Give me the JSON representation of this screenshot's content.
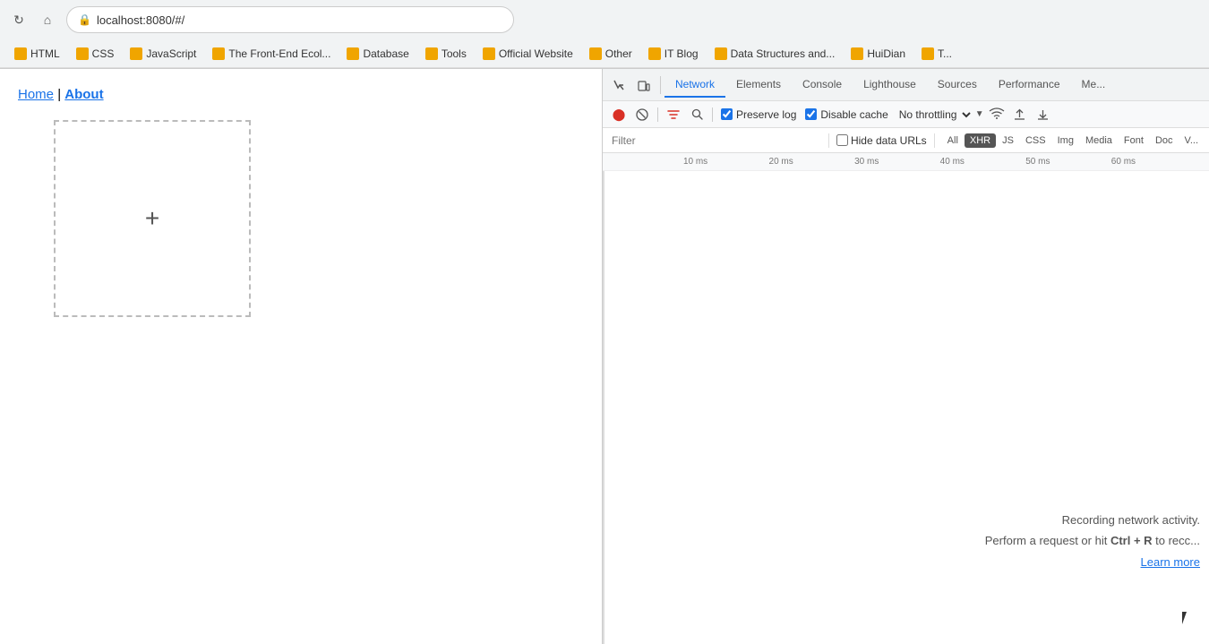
{
  "browser": {
    "url": "localhost:8080/#/",
    "refresh_icon": "↻",
    "home_icon": "⌂"
  },
  "bookmarks": {
    "items": [
      {
        "label": "HTML"
      },
      {
        "label": "CSS"
      },
      {
        "label": "JavaScript"
      },
      {
        "label": "The Front-End Ecol..."
      },
      {
        "label": "Database"
      },
      {
        "label": "Tools"
      },
      {
        "label": "Official Website"
      },
      {
        "label": "Other"
      },
      {
        "label": "IT Blog"
      },
      {
        "label": "Data Structures and..."
      },
      {
        "label": "HuiDian"
      },
      {
        "label": "T..."
      }
    ]
  },
  "page": {
    "nav": {
      "home_label": "Home",
      "separator": " | ",
      "about_label": "About"
    },
    "plus_symbol": "+"
  },
  "devtools": {
    "tabs": [
      {
        "label": "Network",
        "active": true
      },
      {
        "label": "Elements"
      },
      {
        "label": "Console"
      },
      {
        "label": "Lighthouse"
      },
      {
        "label": "Sources"
      },
      {
        "label": "Performance"
      },
      {
        "label": "Me..."
      }
    ],
    "toolbar": {
      "preserve_log_label": "Preserve log",
      "disable_cache_label": "Disable cache",
      "no_throttling_label": "No throttling"
    },
    "filter": {
      "placeholder": "Filter",
      "hide_data_urls_label": "Hide data URLs",
      "types": [
        "All",
        "XHR",
        "JS",
        "CSS",
        "Img",
        "Media",
        "Font",
        "Doc",
        "V..."
      ]
    },
    "timeline": {
      "ticks": [
        "10 ms",
        "20 ms",
        "30 ms",
        "40 ms",
        "50 ms",
        "60 ms"
      ]
    },
    "empty_state": {
      "line1": "Recording network activity.",
      "line2": "Perform a request or hit ",
      "ctrl_r": "Ctrl + R",
      "line2_suffix": " to recc...",
      "learn_more": "Learn more"
    }
  }
}
